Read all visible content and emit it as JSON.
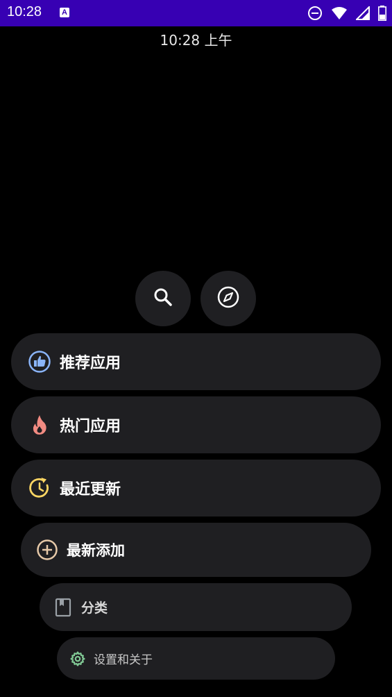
{
  "status_bar": {
    "time": "10:28",
    "notification_icon_letter": "A",
    "icons": [
      "do-not-disturb-icon",
      "wifi-icon",
      "signal-icon",
      "battery-icon"
    ],
    "background": "#3700b3"
  },
  "clock": {
    "text": "10:28 上午"
  },
  "actions": {
    "search_icon": "search-icon",
    "explore_icon": "compass-icon"
  },
  "menu": [
    {
      "label": "推荐应用",
      "icon": "thumbs-up-icon",
      "icon_color": "#8ab4f8"
    },
    {
      "label": "热门应用",
      "icon": "fire-icon",
      "icon_color": "#f28b82"
    },
    {
      "label": "最近更新",
      "icon": "update-clock-icon",
      "icon_color": "#fdd663"
    },
    {
      "label": "最新添加",
      "icon": "add-circle-icon",
      "icon_color": "#e6c9a8"
    },
    {
      "label": "分类",
      "icon": "book-icon",
      "icon_color": "#9aa0a6"
    },
    {
      "label": "设置和关于",
      "icon": "gear-icon",
      "icon_color": "#81c995"
    }
  ]
}
